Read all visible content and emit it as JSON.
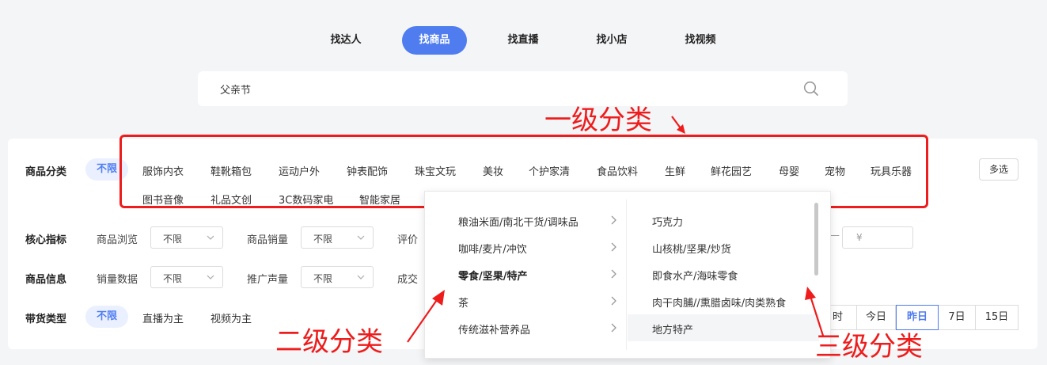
{
  "tabs": [
    {
      "label": "找达人",
      "active": false
    },
    {
      "label": "找商品",
      "active": true
    },
    {
      "label": "找直播",
      "active": false
    },
    {
      "label": "找小店",
      "active": false
    },
    {
      "label": "找视频",
      "active": false
    }
  ],
  "search": {
    "value": "父亲节",
    "icon": "search-icon"
  },
  "category": {
    "label": "商品分类",
    "all": "不限",
    "items": [
      "服饰内衣",
      "鞋靴箱包",
      "运动户外",
      "钟表配饰",
      "珠宝文玩",
      "美妆",
      "个护家清",
      "食品饮料",
      "生鲜",
      "鲜花园艺",
      "母婴",
      "宠物",
      "玩具乐器",
      "图书音像",
      "礼品文创",
      "3C数码家电",
      "智能家居"
    ],
    "multi_select": "多选"
  },
  "core_metrics": {
    "label": "核心指标",
    "fields": [
      {
        "label": "商品浏览",
        "value": "不限"
      },
      {
        "label": "商品销量",
        "value": "不限"
      },
      {
        "label": "评价"
      }
    ],
    "price_separator": "—",
    "price_placeholder": "¥"
  },
  "product_info": {
    "label": "商品信息",
    "fields": [
      {
        "label": "销量数据",
        "value": "不限"
      },
      {
        "label": "推广声量",
        "value": "不限"
      },
      {
        "label": "成交"
      }
    ]
  },
  "sales_type": {
    "label": "带货类型",
    "all": "不限",
    "items": [
      "直播为主",
      "视频为主"
    ]
  },
  "time_range": {
    "items": [
      "时",
      "今日",
      "昨日",
      "7日",
      "15日"
    ],
    "active": "昨日"
  },
  "dropdown": {
    "level2": [
      {
        "label": "粮油米面/南北干货/调味品",
        "bold": false
      },
      {
        "label": "咖啡/麦片/冲饮",
        "bold": false
      },
      {
        "label": "零食/坚果/特产",
        "bold": true
      },
      {
        "label": "茶",
        "bold": false
      },
      {
        "label": "传统滋补营养品",
        "bold": false
      }
    ],
    "level3": [
      "巧克力",
      "山核桃/坚果/炒货",
      "即食水产/海味零食",
      "肉干肉脯//熏腊卤味/肉类熟食",
      "地方特产"
    ]
  },
  "annotations": {
    "level1": "一级分类",
    "level2": "二级分类",
    "level3": "三级分类",
    "color": "#ee1c1c"
  },
  "colors": {
    "accent": "#4f7df0",
    "annotation": "#ee1c1c",
    "background": "#f4f5f7"
  }
}
